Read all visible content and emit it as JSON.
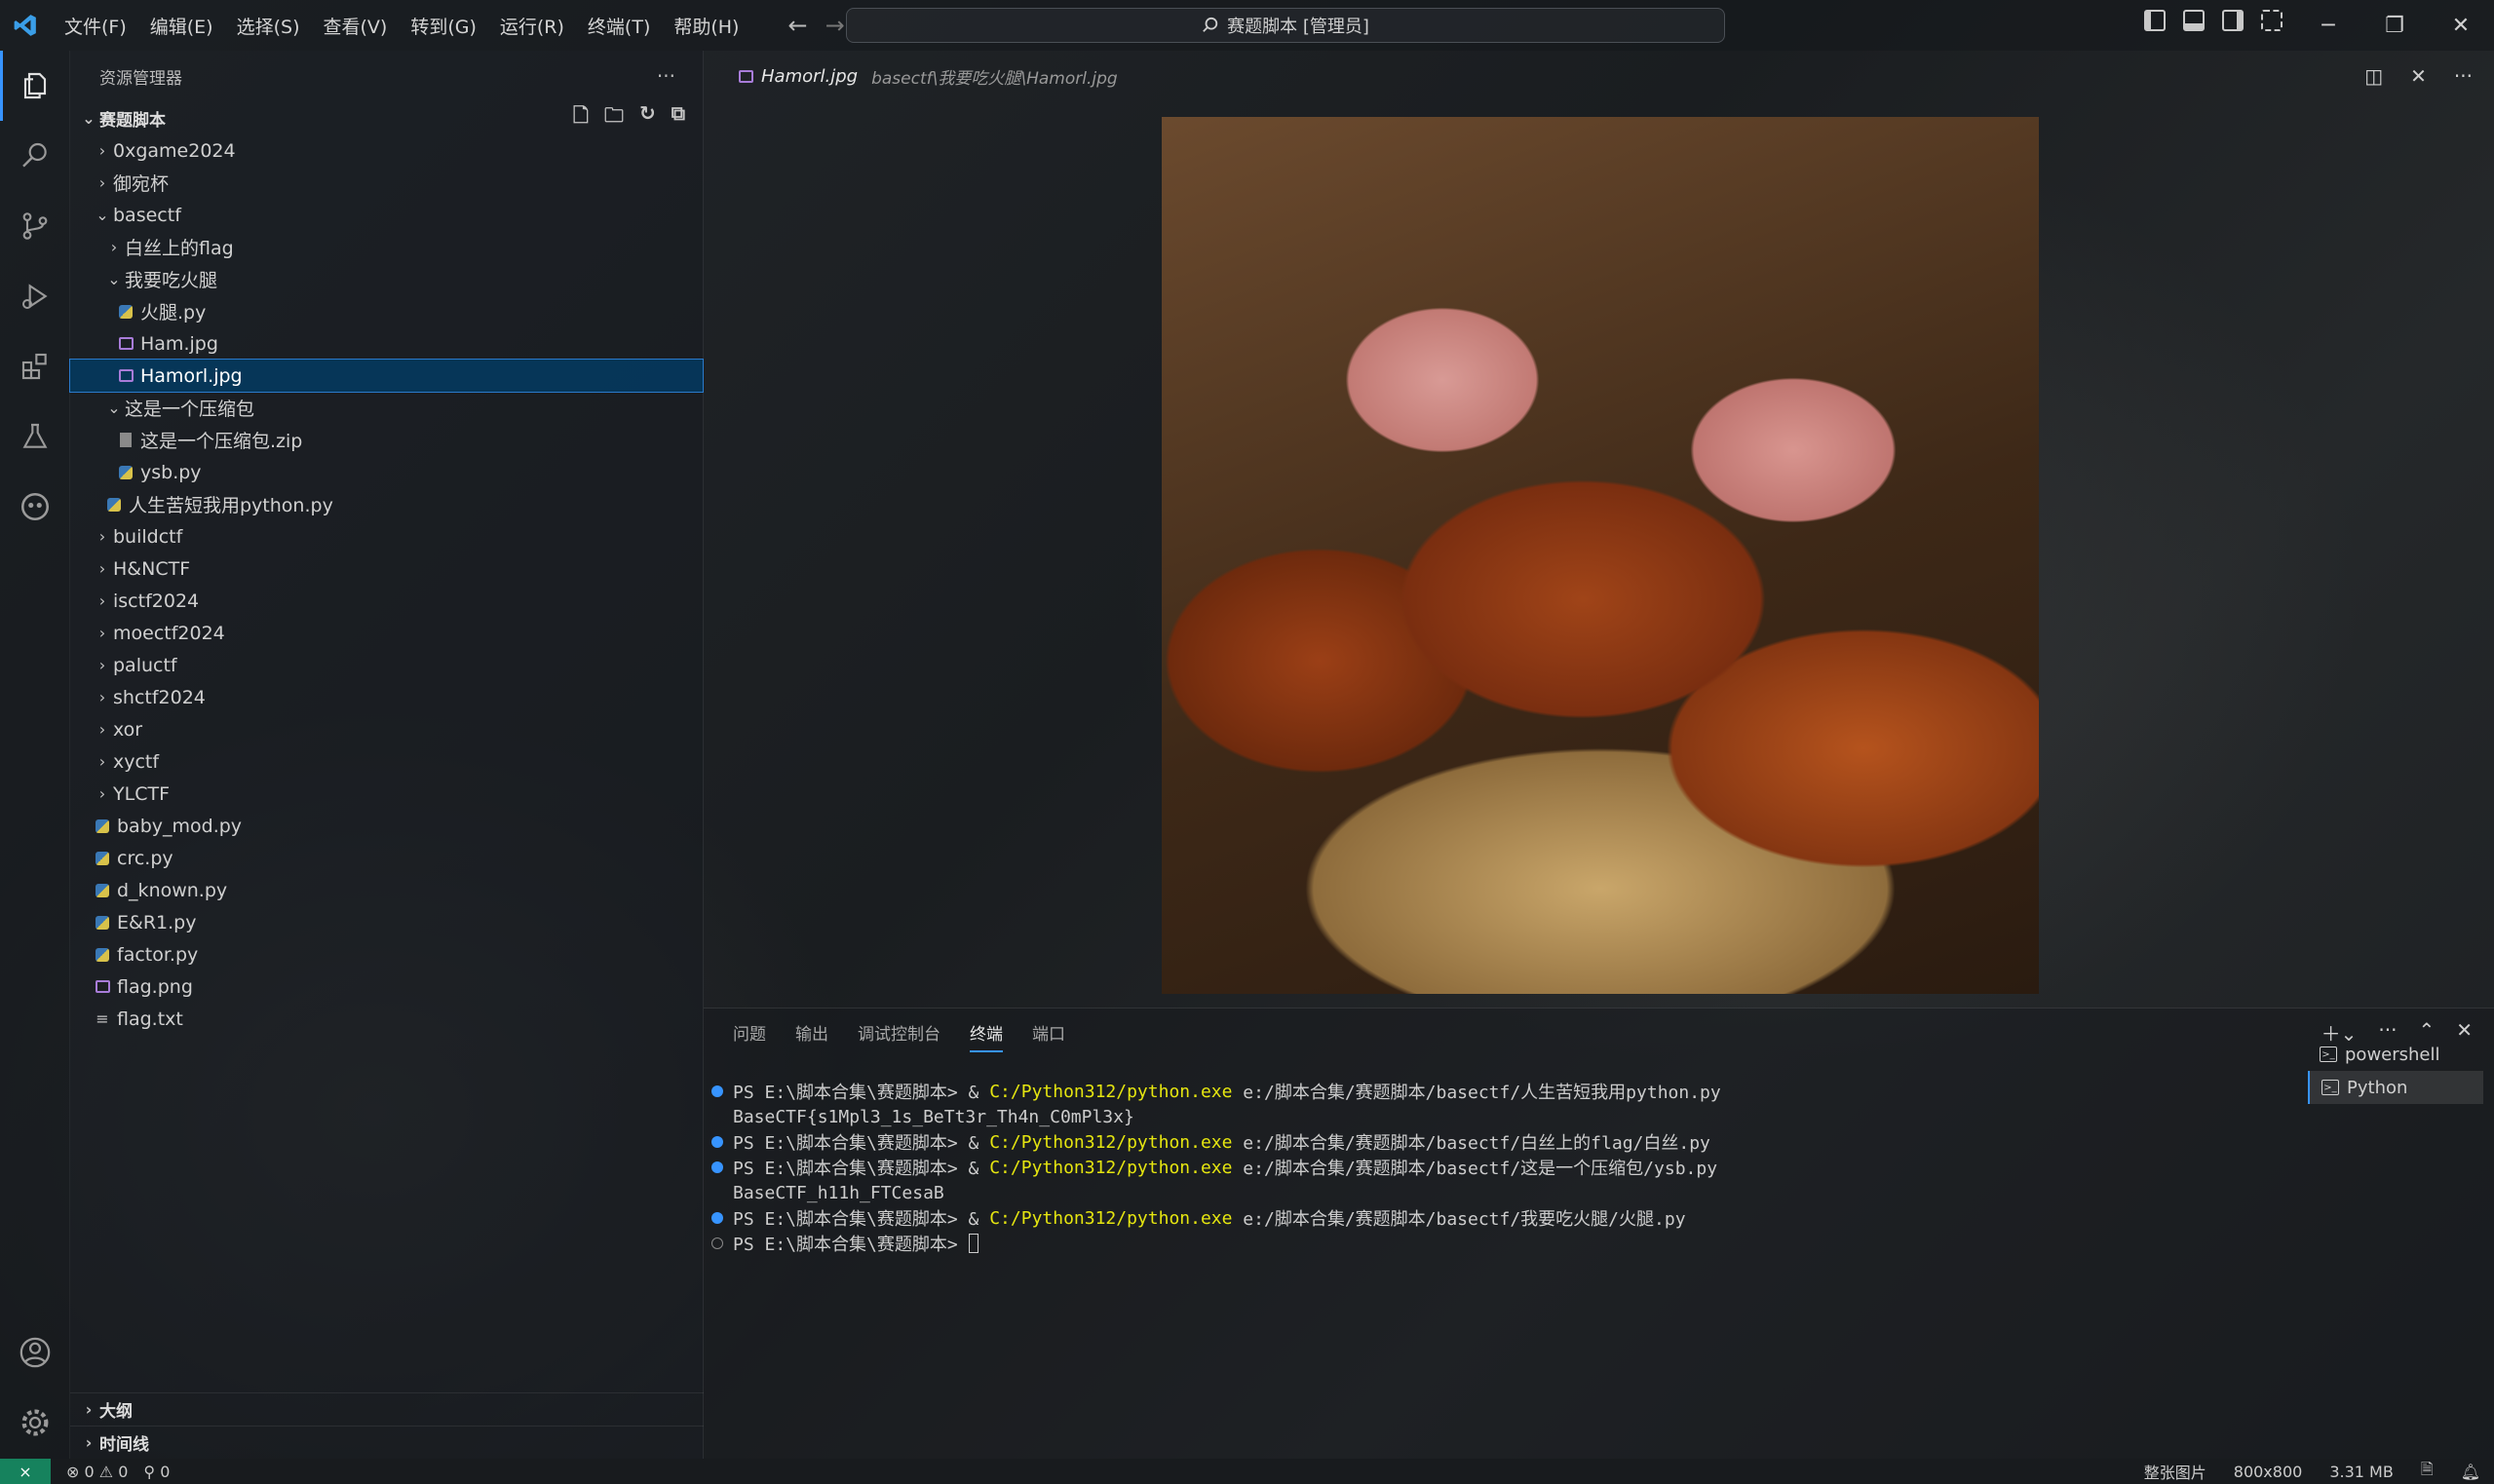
{
  "titlebar": {
    "menus": [
      "文件(F)",
      "编辑(E)",
      "选择(S)",
      "查看(V)",
      "转到(G)",
      "运行(R)",
      "终端(T)",
      "帮助(H)"
    ],
    "command_center": "赛题脚本 [管理员]"
  },
  "sidebar": {
    "title": "资源管理器",
    "workspace": "赛题脚本",
    "tree": [
      {
        "label": "0xgame2024",
        "depth": 0,
        "type": "folder",
        "open": false
      },
      {
        "label": "御宛杯",
        "depth": 0,
        "type": "folder",
        "open": false
      },
      {
        "label": "basectf",
        "depth": 0,
        "type": "folder",
        "open": true
      },
      {
        "label": "白丝上的flag",
        "depth": 1,
        "type": "folder",
        "open": false
      },
      {
        "label": "我要吃火腿",
        "depth": 1,
        "type": "folder",
        "open": true
      },
      {
        "label": "火腿.py",
        "depth": 2,
        "type": "py"
      },
      {
        "label": "Ham.jpg",
        "depth": 2,
        "type": "img"
      },
      {
        "label": "Hamorl.jpg",
        "depth": 2,
        "type": "img",
        "selected": true
      },
      {
        "label": "这是一个压缩包",
        "depth": 1,
        "type": "folder",
        "open": true
      },
      {
        "label": "这是一个压缩包.zip",
        "depth": 2,
        "type": "zip"
      },
      {
        "label": "ysb.py",
        "depth": 2,
        "type": "py"
      },
      {
        "label": "人生苦短我用python.py",
        "depth": 1,
        "type": "py"
      },
      {
        "label": "buildctf",
        "depth": 0,
        "type": "folder",
        "open": false
      },
      {
        "label": "H&NCTF",
        "depth": 0,
        "type": "folder",
        "open": false
      },
      {
        "label": "isctf2024",
        "depth": 0,
        "type": "folder",
        "open": false
      },
      {
        "label": "moectf2024",
        "depth": 0,
        "type": "folder",
        "open": false
      },
      {
        "label": "paluctf",
        "depth": 0,
        "type": "folder",
        "open": false
      },
      {
        "label": "shctf2024",
        "depth": 0,
        "type": "folder",
        "open": false
      },
      {
        "label": "xor",
        "depth": 0,
        "type": "folder",
        "open": false
      },
      {
        "label": "xyctf",
        "depth": 0,
        "type": "folder",
        "open": false
      },
      {
        "label": "YLCTF",
        "depth": 0,
        "type": "folder",
        "open": false
      },
      {
        "label": "baby_mod.py",
        "depth": 0,
        "type": "py"
      },
      {
        "label": "crc.py",
        "depth": 0,
        "type": "py"
      },
      {
        "label": "d_known.py",
        "depth": 0,
        "type": "py"
      },
      {
        "label": "E&R1.py",
        "depth": 0,
        "type": "py"
      },
      {
        "label": "factor.py",
        "depth": 0,
        "type": "py"
      },
      {
        "label": "flag.png",
        "depth": 0,
        "type": "img"
      },
      {
        "label": "flag.txt",
        "depth": 0,
        "type": "txt"
      }
    ],
    "outline": "大纲",
    "timeline": "时间线"
  },
  "editor": {
    "tab_file": "Hamorl.jpg",
    "tab_path": "basectf\\我要吃火腿\\Hamorl.jpg"
  },
  "panel": {
    "tabs": [
      "问题",
      "输出",
      "调试控制台",
      "终端",
      "端口"
    ],
    "active_tab": "终端",
    "terminal_lines": [
      {
        "dot": "blue",
        "prompt": "PS E:\\脚本合集\\赛题脚本> & ",
        "exe": "C:/Python312/python.exe",
        "rest": " e:/脚本合集/赛题脚本/basectf/人生苦短我用python.py"
      },
      {
        "dot": "none",
        "text": "BaseCTF{s1Mpl3_1s_BeTt3r_Th4n_C0mPl3x}"
      },
      {
        "dot": "blue",
        "prompt": "PS E:\\脚本合集\\赛题脚本> & ",
        "exe": "C:/Python312/python.exe",
        "rest": " e:/脚本合集/赛题脚本/basectf/白丝上的flag/白丝.py"
      },
      {
        "dot": "blue",
        "prompt": "PS E:\\脚本合集\\赛题脚本> & ",
        "exe": "C:/Python312/python.exe",
        "rest": " e:/脚本合集/赛题脚本/basectf/这是一个压缩包/ysb.py"
      },
      {
        "dot": "none",
        "text": "BaseCTF_h11h_FTCesaB"
      },
      {
        "dot": "blue",
        "prompt": "PS E:\\脚本合集\\赛题脚本> & ",
        "exe": "C:/Python312/python.exe",
        "rest": " e:/脚本合集/赛题脚本/basectf/我要吃火腿/火腿.py"
      },
      {
        "dot": "empty",
        "text": "PS E:\\脚本合集\\赛题脚本> ",
        "cursor": true
      }
    ],
    "terminals": [
      {
        "name": "powershell",
        "active": false
      },
      {
        "name": "Python",
        "active": true
      }
    ]
  },
  "statusbar": {
    "errors": "0",
    "warnings": "0",
    "ports": "0",
    "view_mode": "整张图片",
    "dimensions": "800x800",
    "size": "3.31 MB"
  }
}
